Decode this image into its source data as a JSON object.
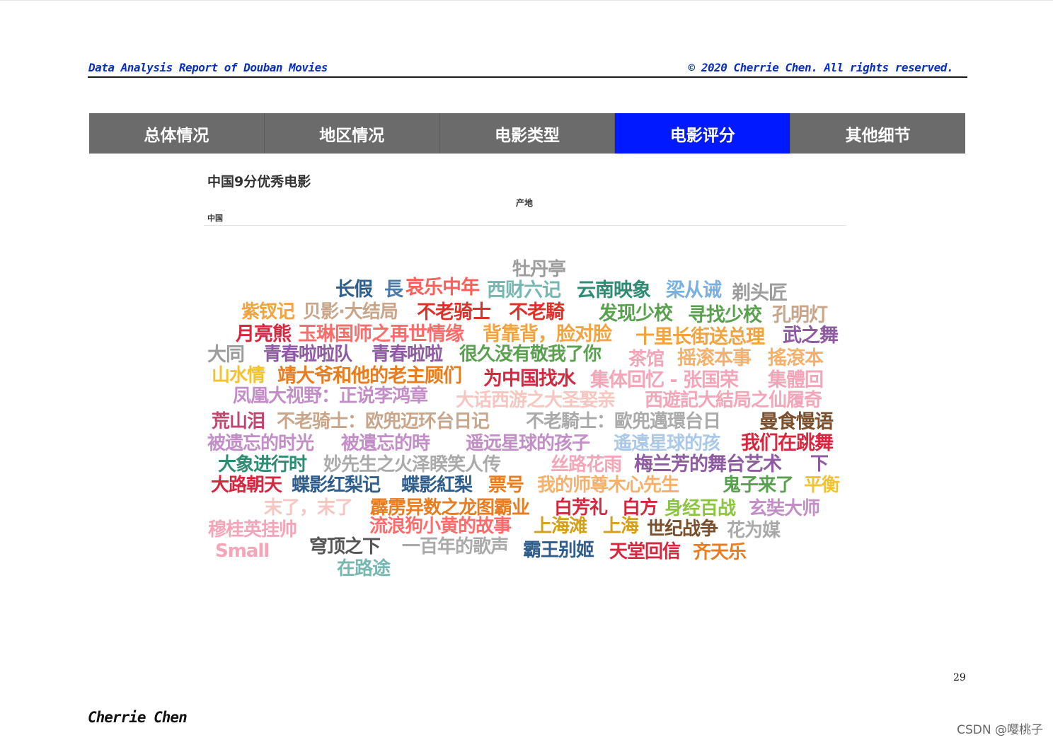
{
  "header": {
    "left_title": "Data Analysis Report of Douban Movies",
    "right_title": "© 2020 Cherrie Chen. All rights reserved."
  },
  "nav": {
    "tabs": [
      "总体情况",
      "地区情况",
      "电影类型",
      "电影评分",
      "其他细节"
    ],
    "active_index": 3,
    "colors": {
      "tab": "#6b6b6b",
      "active": "#0019ff",
      "text": "#ffffff"
    }
  },
  "panel": {
    "title": "中国9分优秀电影",
    "filter_label": "产地",
    "filter_value": "中国"
  },
  "wordcloud": {
    "words": [
      {
        "text": "牡丹亭",
        "color": "#9c9c9c"
      },
      {
        "text": "长假",
        "color": "#2f5d8c"
      },
      {
        "text": "長",
        "color": "#4e79a7"
      },
      {
        "text": "哀乐中年",
        "color": "#ff5e5b"
      },
      {
        "text": "西财六记",
        "color": "#76b7b2"
      },
      {
        "text": "云南映象",
        "color": "#2e8b74"
      },
      {
        "text": "梁从诫",
        "color": "#7ab0e0"
      },
      {
        "text": "剃头匠",
        "color": "#9c9c9c"
      },
      {
        "text": "紫钗记",
        "color": "#f1a340"
      },
      {
        "text": "贝影·大结局",
        "color": "#c9a58a"
      },
      {
        "text": "不老骑士",
        "color": "#e0302a"
      },
      {
        "text": "不老騎",
        "color": "#e0302a"
      },
      {
        "text": "发现少校",
        "color": "#59a14f"
      },
      {
        "text": "寻找少校",
        "color": "#59a14f"
      },
      {
        "text": "孔明灯",
        "color": "#c9a58a"
      },
      {
        "text": "月亮熊",
        "color": "#d6273f"
      },
      {
        "text": "玉琳国师之再世情缘",
        "color": "#ff6b6b"
      },
      {
        "text": "背靠背，脸对脸",
        "color": "#f1a340"
      },
      {
        "text": "十里长街送总理",
        "color": "#f1a340"
      },
      {
        "text": "武之舞",
        "color": "#8e5aa2"
      },
      {
        "text": "大同",
        "color": "#9c9c9c"
      },
      {
        "text": "青春啦啦队",
        "color": "#8e5aa2"
      },
      {
        "text": "青春啦啦",
        "color": "#8e5aa2"
      },
      {
        "text": "很久没有敬我了你",
        "color": "#59a14f"
      },
      {
        "text": "茶馆",
        "color": "#f4a6b8"
      },
      {
        "text": "摇滚本事",
        "color": "#f7b06a"
      },
      {
        "text": "搖滾本",
        "color": "#f7b06a"
      },
      {
        "text": "山水情",
        "color": "#f2c230"
      },
      {
        "text": "靖大爷和他的老主顾们",
        "color": "#e87c1e"
      },
      {
        "text": "为中国找水",
        "color": "#d6273f"
      },
      {
        "text": "集体回忆 - 张国荣",
        "color": "#f4a6b8"
      },
      {
        "text": "集體回",
        "color": "#f4a6b8"
      },
      {
        "text": "凤凰大视野：正说李鸿章",
        "color": "#c38ec7"
      },
      {
        "text": "大话西游之大圣娶亲",
        "color": "#f7c6c0"
      },
      {
        "text": "西遊記大結局之仙履奇",
        "color": "#f4a6b8"
      },
      {
        "text": "荒山泪",
        "color": "#c2456e"
      },
      {
        "text": "不老骑士：欧兜迈环台日记",
        "color": "#c9a58a"
      },
      {
        "text": "不老騎士：歐兜邁環台日",
        "color": "#aaaaaa"
      },
      {
        "text": "曼食慢语",
        "color": "#7b4f2c"
      },
      {
        "text": "被遗忘的时光",
        "color": "#c38ec7"
      },
      {
        "text": "被遺忘的時",
        "color": "#c38ec7"
      },
      {
        "text": "遥远星球的孩子",
        "color": "#c38ec7"
      },
      {
        "text": "遙遠星球的孩",
        "color": "#aac8e8"
      },
      {
        "text": "我们在跳舞",
        "color": "#d6273f"
      },
      {
        "text": "大象进行时",
        "color": "#2e8b74"
      },
      {
        "text": "妙先生之火泽睽笑人传",
        "color": "#aaaaaa"
      },
      {
        "text": "丝路花雨",
        "color": "#f4a6b8"
      },
      {
        "text": "梅兰芳的舞台艺术",
        "color": "#8e5aa2"
      },
      {
        "text": "下",
        "color": "#8e5aa2"
      },
      {
        "text": "大路朝天",
        "color": "#d6273f"
      },
      {
        "text": "蝶影红梨记",
        "color": "#2f5d8c"
      },
      {
        "text": "蝶影紅梨",
        "color": "#2f5d8c"
      },
      {
        "text": "票号",
        "color": "#e87c1e"
      },
      {
        "text": "我的师尊木心先生",
        "color": "#f7b06a"
      },
      {
        "text": "鬼子来了",
        "color": "#59a14f"
      },
      {
        "text": "平衡",
        "color": "#f2c230"
      },
      {
        "text": "末了，末了",
        "color": "#f7c6c0"
      },
      {
        "text": "霹雳异数之龙图霸业",
        "color": "#e87c1e"
      },
      {
        "text": "白芳礼",
        "color": "#d6273f"
      },
      {
        "text": "白方",
        "color": "#d6273f"
      },
      {
        "text": "身经百战",
        "color": "#8cc63f"
      },
      {
        "text": "玄奘大师",
        "color": "#c38ec7"
      },
      {
        "text": "穆桂英挂帅",
        "color": "#f4a6b8"
      },
      {
        "text": "流浪狗小黄的故事",
        "color": "#ff6b6b"
      },
      {
        "text": "上海滩",
        "color": "#d4a017"
      },
      {
        "text": "上海",
        "color": "#d4a017"
      },
      {
        "text": "世纪战争",
        "color": "#7b4f2c"
      },
      {
        "text": "花为媒",
        "color": "#aaaaaa"
      },
      {
        "text": "Small",
        "color": "#f4a6b8"
      },
      {
        "text": "穹顶之下",
        "color": "#555555"
      },
      {
        "text": "一百年的歌声",
        "color": "#aaaaaa"
      },
      {
        "text": "霸王别姬",
        "color": "#2f5d8c"
      },
      {
        "text": "天堂回信",
        "color": "#d6273f"
      },
      {
        "text": "齐天乐",
        "color": "#e87c1e"
      },
      {
        "text": "在路途",
        "color": "#76b7b2"
      }
    ]
  },
  "footer": {
    "page_number": "29",
    "author": "Cherrie Chen",
    "watermark": "CSDN @嘤桃子"
  }
}
